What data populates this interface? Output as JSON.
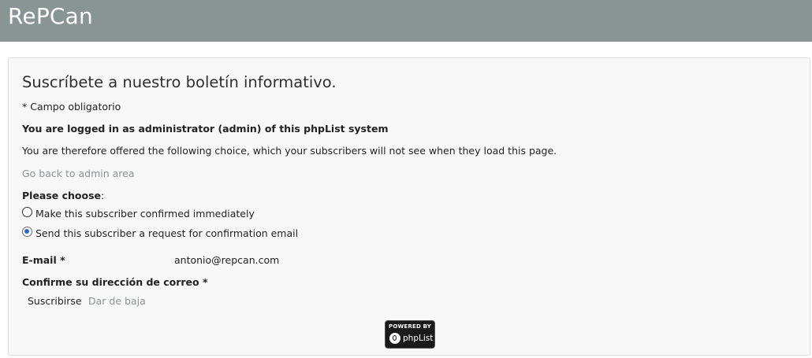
{
  "header": {
    "title": "RePCan"
  },
  "form": {
    "title": "Suscríbete a nuestro boletín informativo.",
    "required_note": "* Campo obligatorio",
    "admin_notice": "You are logged in as administrator (admin) of this phpList system",
    "offer_text": "You are therefore offered the following choice, which your subscribers will not see when they load this page.",
    "admin_link": "Go back to admin area",
    "choose_label": "Please choose",
    "choose_colon": ":",
    "options": [
      {
        "label": "Make this subscriber confirmed immediately",
        "selected": false
      },
      {
        "label": "Send this subscriber a request for confirmation email",
        "selected": true
      }
    ],
    "email_label": "E-mail *",
    "email_value": "antonio@repcan.com",
    "confirm_label": "Confirme su dirección de correo *",
    "subscribe_label": "Suscribirse",
    "unsubscribe_label": "Dar de baja"
  },
  "badge": {
    "top": "POWERED BY",
    "name": "phpList"
  },
  "colors": {
    "header_bg": "#899494",
    "radio_accent": "#2b68c8",
    "link": "#8a9494"
  }
}
